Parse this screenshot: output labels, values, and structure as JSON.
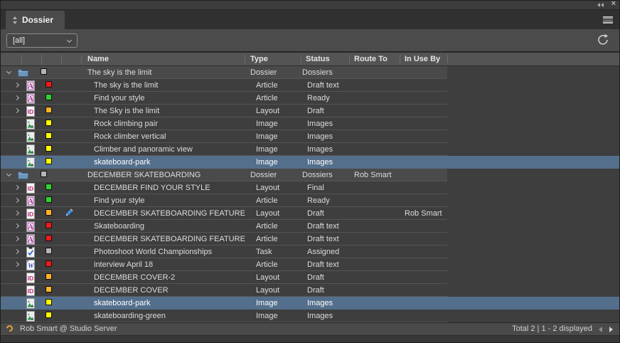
{
  "panel": {
    "title": "Dossier"
  },
  "toolbar": {
    "filter_value": "[all]"
  },
  "table": {
    "columns": [
      "Name",
      "Type",
      "Status",
      "Route To",
      "In Use By"
    ],
    "rows": [
      {
        "level": 0,
        "chevron": "down",
        "icon": "folder",
        "square": "gray",
        "name": "The sky is the limit",
        "type": "Dossier",
        "status": "Dossiers",
        "route_to": "",
        "in_use_by": "",
        "selected": false,
        "editing": false
      },
      {
        "level": 1,
        "chevron": "right",
        "icon": "article",
        "square": "red",
        "name": "The sky is the limit",
        "type": "Article",
        "status": "Draft text",
        "route_to": "",
        "in_use_by": "",
        "selected": false,
        "editing": false
      },
      {
        "level": 1,
        "chevron": "right",
        "icon": "article",
        "square": "green",
        "name": "Find your style",
        "type": "Article",
        "status": "Ready",
        "route_to": "",
        "in_use_by": "",
        "selected": false,
        "editing": false
      },
      {
        "level": 1,
        "chevron": "right",
        "icon": "indesign",
        "square": "amber",
        "name": "The Sky is the limit",
        "type": "Layout",
        "status": "Draft",
        "route_to": "",
        "in_use_by": "",
        "selected": false,
        "editing": false
      },
      {
        "level": 1,
        "chevron": "none",
        "icon": "image",
        "square": "yellow",
        "name": "Rock climbing pair",
        "type": "Image",
        "status": "Images",
        "route_to": "",
        "in_use_by": "",
        "selected": false,
        "editing": false
      },
      {
        "level": 1,
        "chevron": "none",
        "icon": "image",
        "square": "yellow",
        "name": "Rock climber vertical",
        "type": "Image",
        "status": "Images",
        "route_to": "",
        "in_use_by": "",
        "selected": false,
        "editing": false
      },
      {
        "level": 1,
        "chevron": "none",
        "icon": "image",
        "square": "yellow",
        "name": "Climber and panoramic view",
        "type": "Image",
        "status": "Images",
        "route_to": "",
        "in_use_by": "",
        "selected": false,
        "editing": false
      },
      {
        "level": 1,
        "chevron": "none",
        "icon": "image",
        "square": "yellow",
        "name": "skateboard-park",
        "type": "Image",
        "status": "Images",
        "route_to": "",
        "in_use_by": "",
        "selected": true,
        "editing": false
      },
      {
        "level": 0,
        "chevron": "down",
        "icon": "folder",
        "square": "gray",
        "name": "DECEMBER SKATEBOARDING",
        "type": "Dossier",
        "status": "Dossiers",
        "route_to": "Rob Smart",
        "in_use_by": "",
        "selected": false,
        "editing": false
      },
      {
        "level": 1,
        "chevron": "right",
        "icon": "indesign",
        "square": "green",
        "name": "DECEMBER FIND YOUR STYLE",
        "type": "Layout",
        "status": "Final",
        "route_to": "",
        "in_use_by": "",
        "selected": false,
        "editing": false
      },
      {
        "level": 1,
        "chevron": "right",
        "icon": "article",
        "square": "green",
        "name": "Find your style",
        "type": "Article",
        "status": "Ready",
        "route_to": "",
        "in_use_by": "",
        "selected": false,
        "editing": false
      },
      {
        "level": 1,
        "chevron": "right",
        "icon": "indesign",
        "square": "amber",
        "name": "DECEMBER SKATEBOARDING FEATURE",
        "type": "Layout",
        "status": "Draft",
        "route_to": "",
        "in_use_by": "Rob Smart",
        "selected": false,
        "editing": true
      },
      {
        "level": 1,
        "chevron": "right",
        "icon": "article",
        "square": "red",
        "name": "Skateboarding",
        "type": "Article",
        "status": "Draft text",
        "route_to": "",
        "in_use_by": "",
        "selected": false,
        "editing": false
      },
      {
        "level": 1,
        "chevron": "right",
        "icon": "article",
        "square": "red",
        "name": "DECEMBER SKATEBOARDING FEATURE",
        "type": "Article",
        "status": "Draft text",
        "route_to": "",
        "in_use_by": "",
        "selected": false,
        "editing": false
      },
      {
        "level": 1,
        "chevron": "right",
        "icon": "task",
        "square": "gray",
        "name": "Photoshoot World Championships",
        "type": "Task",
        "status": "Assigned",
        "route_to": "",
        "in_use_by": "",
        "selected": false,
        "editing": false
      },
      {
        "level": 1,
        "chevron": "right",
        "icon": "word",
        "square": "red",
        "name": "interview April 18",
        "type": "Article",
        "status": "Draft text",
        "route_to": "",
        "in_use_by": "",
        "selected": false,
        "editing": false
      },
      {
        "level": 1,
        "chevron": "none",
        "icon": "indesign",
        "square": "amber",
        "name": "DECEMBER COVER-2",
        "type": "Layout",
        "status": "Draft",
        "route_to": "",
        "in_use_by": "",
        "selected": false,
        "editing": false
      },
      {
        "level": 1,
        "chevron": "none",
        "icon": "indesign",
        "square": "amber",
        "name": "DECEMBER COVER",
        "type": "Layout",
        "status": "Draft",
        "route_to": "",
        "in_use_by": "",
        "selected": false,
        "editing": false
      },
      {
        "level": 1,
        "chevron": "none",
        "icon": "image",
        "square": "yellow",
        "name": "skateboard-park",
        "type": "Image",
        "status": "Images",
        "route_to": "",
        "in_use_by": "",
        "selected": true,
        "editing": false
      },
      {
        "level": 1,
        "chevron": "none",
        "icon": "image",
        "square": "yellow",
        "name": "skateboarding-green",
        "type": "Image",
        "status": "Images",
        "route_to": "",
        "in_use_by": "",
        "selected": false,
        "editing": false
      }
    ]
  },
  "statusbar": {
    "connection": "Rob Smart @ Studio Server",
    "pagination": "Total 2 | 1 - 2 displayed"
  },
  "colors": {
    "selection": "#546f8c",
    "squares": {
      "gray": "#b5b5b5",
      "red": "#f11a1a",
      "green": "#2fd32f",
      "amber": "#fcb326",
      "yellow": "#ffff00"
    }
  }
}
